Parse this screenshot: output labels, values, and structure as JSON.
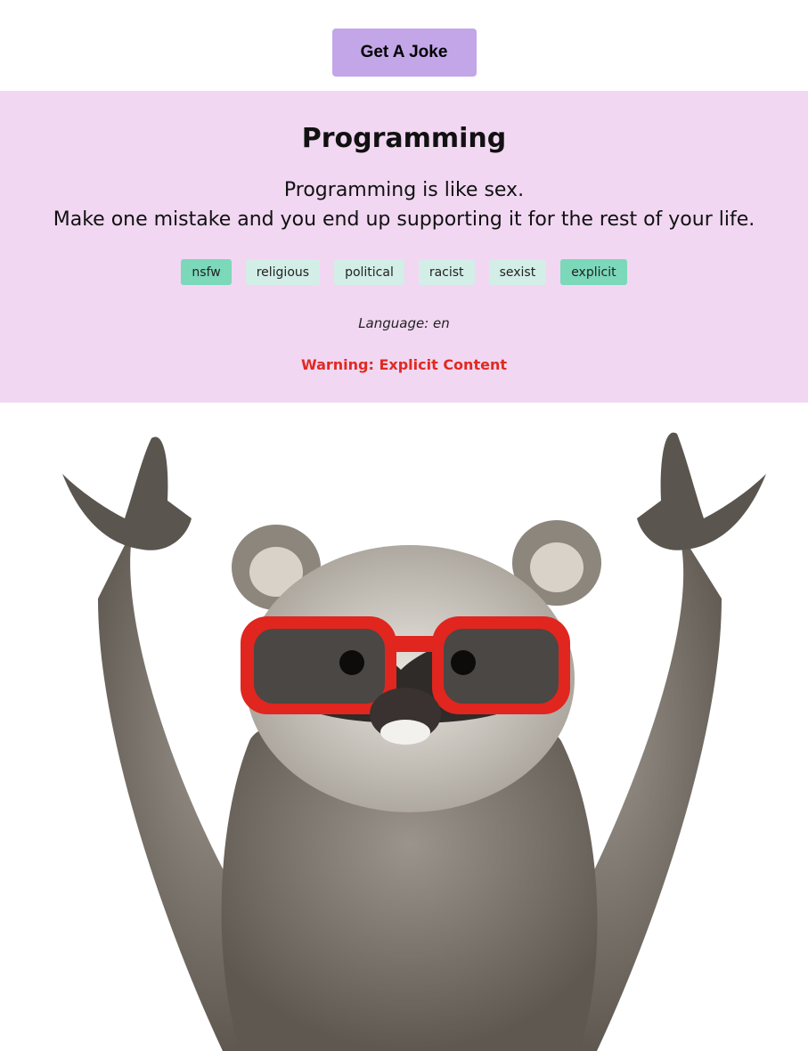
{
  "button": {
    "label": "Get A Joke"
  },
  "joke": {
    "category": "Programming",
    "line1": "Programming is like sex.",
    "line2": "Make one mistake and you end up supporting it for the rest of your life.",
    "language_label": "Language: en",
    "warning": "Warning: Explicit Content",
    "flags": [
      {
        "label": "nsfw",
        "active": true
      },
      {
        "label": "religious",
        "active": false
      },
      {
        "label": "political",
        "active": false
      },
      {
        "label": "racist",
        "active": false
      },
      {
        "label": "sexist",
        "active": false
      },
      {
        "label": "explicit",
        "active": true
      }
    ]
  },
  "colors": {
    "button_bg": "#c3a6e8",
    "card_bg": "#f1d7f2",
    "flag_active": "#7bd8b9",
    "flag_inactive": "#d3eee6",
    "warning": "#e02a21"
  }
}
